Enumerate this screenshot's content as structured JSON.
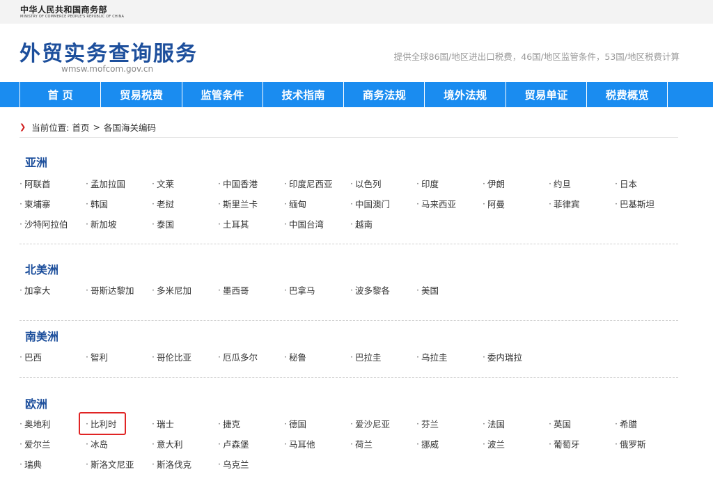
{
  "header": {
    "ministry_cn": "中华人民共和国商务部",
    "ministry_en": "MINISTRY OF COMMERCE PEOPLE'S REPUBLIC OF CHINA",
    "site_title": "外贸实务查询服务",
    "site_url": "wmsw.mofcom.gov.cn",
    "tagline": "提供全球86国/地区进出口税费，46国/地区监管条件，53国/地区税费计算"
  },
  "nav": [
    "首 页",
    "贸易税费",
    "监管条件",
    "技术指南",
    "商务法规",
    "境外法规",
    "贸易单证",
    "税费概览"
  ],
  "breadcrumb": {
    "label": "当前位置:",
    "home": "首页",
    "separator": ">",
    "current": "各国海关编码"
  },
  "regions": [
    {
      "name": "亚洲",
      "countries": [
        "阿联酋",
        "孟加拉国",
        "文莱",
        "中国香港",
        "印度尼西亚",
        "以色列",
        "印度",
        "伊朗",
        "约旦",
        "日本",
        "柬埔寨",
        "韩国",
        "老挝",
        "斯里兰卡",
        "缅甸",
        "中国澳门",
        "马来西亚",
        "阿曼",
        "菲律宾",
        "巴基斯坦",
        "沙特阿拉伯",
        "新加坡",
        "泰国",
        "土耳其",
        "中国台湾",
        "越南"
      ]
    },
    {
      "name": "北美洲",
      "countries": [
        "加拿大",
        "哥斯达黎加",
        "多米尼加",
        "墨西哥",
        "巴拿马",
        "波多黎各",
        "美国"
      ]
    },
    {
      "name": "南美洲",
      "countries": [
        "巴西",
        "智利",
        "哥伦比亚",
        "厄瓜多尔",
        "秘鲁",
        "巴拉圭",
        "乌拉圭",
        "委内瑞拉"
      ]
    },
    {
      "name": "欧洲",
      "countries": [
        "奥地利",
        "比利时",
        "瑞士",
        "捷克",
        "德国",
        "爱沙尼亚",
        "芬兰",
        "法国",
        "英国",
        "希腊",
        "爱尔兰",
        "冰岛",
        "意大利",
        "卢森堡",
        "马耳他",
        "荷兰",
        "挪威",
        "波兰",
        "葡萄牙",
        "俄罗斯",
        "瑞典",
        "斯洛文尼亚",
        "斯洛伐克",
        "乌克兰"
      ]
    }
  ],
  "highlight_color": "#e02424",
  "accent_color": "#1a8cf0",
  "title_color": "#1d4f9c"
}
